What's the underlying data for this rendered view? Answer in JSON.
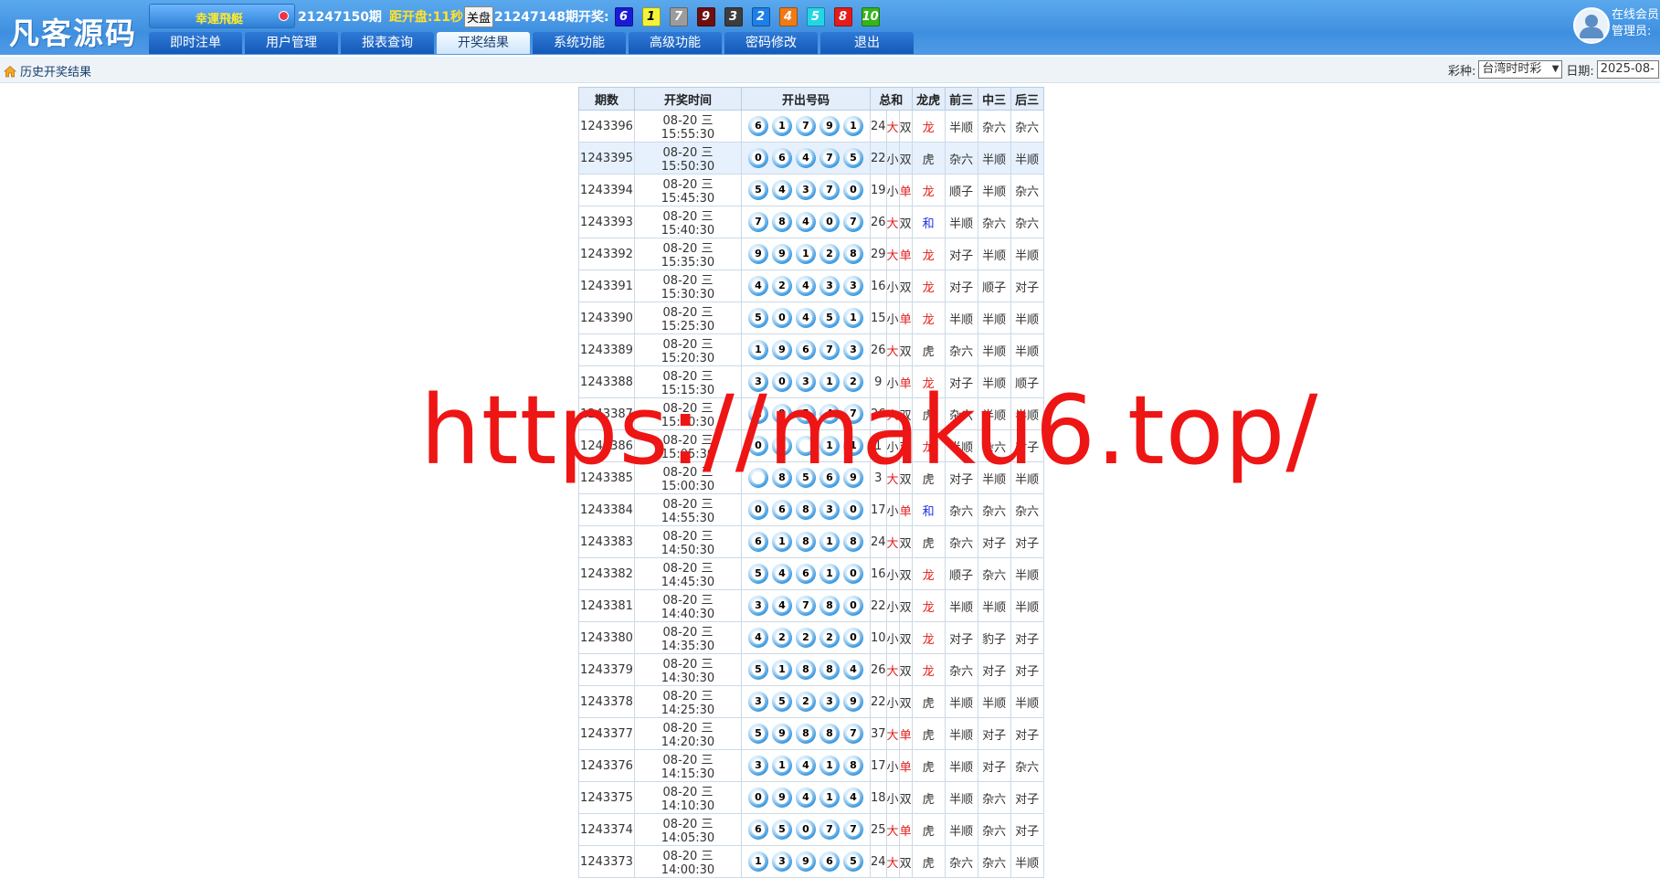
{
  "header": {
    "logo": "凡客源码",
    "game_name": "幸運飛艇",
    "current_issue": "21247150期",
    "countdown": "距开盘:11秒",
    "close_label": "关盘",
    "last_issue": "21247148期开奖:",
    "result_balls": [
      {
        "n": "6",
        "bg": "#1a1ad6",
        "fg": "#ffffff"
      },
      {
        "n": "1",
        "bg": "#f5f23a",
        "fg": "#000000"
      },
      {
        "n": "7",
        "bg": "#9c9c9c",
        "fg": "#ffffff"
      },
      {
        "n": "9",
        "bg": "#6e0f0f",
        "fg": "#ffffff"
      },
      {
        "n": "3",
        "bg": "#3d3d3d",
        "fg": "#ffffff"
      },
      {
        "n": "2",
        "bg": "#1d7fe8",
        "fg": "#ffffff"
      },
      {
        "n": "4",
        "bg": "#f07a16",
        "fg": "#ffffff"
      },
      {
        "n": "5",
        "bg": "#22d6e8",
        "fg": "#ffffff"
      },
      {
        "n": "8",
        "bg": "#e41b1b",
        "fg": "#ffffff"
      },
      {
        "n": "10",
        "bg": "#35b51a",
        "fg": "#ffffff"
      }
    ],
    "nav": [
      "即时注单",
      "用户管理",
      "报表查询",
      "开奖结果",
      "系统功能",
      "高级功能",
      "密码修改",
      "退出"
    ],
    "active_nav": 3,
    "user_line1": "在线会员",
    "user_line2": "管理员:"
  },
  "subbar": {
    "crumb": "历史开奖结果",
    "lottery_label": "彩种:",
    "lottery_value": "台湾时时彩",
    "date_label": "日期:",
    "date_value": "2025-08-"
  },
  "table": {
    "headers": [
      "期数",
      "开奖时间",
      "开出号码",
      "总和",
      "龙虎",
      "前三",
      "中三",
      "后三"
    ],
    "rows": [
      {
        "id": "1243396",
        "time": "08-20 三 15:55:30",
        "balls": [
          "6",
          "1",
          "7",
          "9",
          "1"
        ],
        "sum": "24",
        "bs": "大",
        "oe": "双",
        "dt": "龙",
        "f3": "半顺",
        "m3": "杂六",
        "b3": "杂六"
      },
      {
        "id": "1243395",
        "time": "08-20 三 15:50:30",
        "balls": [
          "0",
          "6",
          "4",
          "7",
          "5"
        ],
        "sum": "22",
        "bs": "小",
        "oe": "双",
        "dt": "虎",
        "f3": "杂六",
        "m3": "半顺",
        "b3": "半顺"
      },
      {
        "id": "1243394",
        "time": "08-20 三 15:45:30",
        "balls": [
          "5",
          "4",
          "3",
          "7",
          "0"
        ],
        "sum": "19",
        "bs": "小",
        "oe": "单",
        "dt": "龙",
        "f3": "顺子",
        "m3": "半顺",
        "b3": "杂六"
      },
      {
        "id": "1243393",
        "time": "08-20 三 15:40:30",
        "balls": [
          "7",
          "8",
          "4",
          "0",
          "7"
        ],
        "sum": "26",
        "bs": "大",
        "oe": "双",
        "dt": "和",
        "f3": "半顺",
        "m3": "杂六",
        "b3": "杂六"
      },
      {
        "id": "1243392",
        "time": "08-20 三 15:35:30",
        "balls": [
          "9",
          "9",
          "1",
          "2",
          "8"
        ],
        "sum": "29",
        "bs": "大",
        "oe": "单",
        "dt": "龙",
        "f3": "对子",
        "m3": "半顺",
        "b3": "半顺"
      },
      {
        "id": "1243391",
        "time": "08-20 三 15:30:30",
        "balls": [
          "4",
          "2",
          "4",
          "3",
          "3"
        ],
        "sum": "16",
        "bs": "小",
        "oe": "双",
        "dt": "龙",
        "f3": "对子",
        "m3": "顺子",
        "b3": "对子"
      },
      {
        "id": "1243390",
        "time": "08-20 三 15:25:30",
        "balls": [
          "5",
          "0",
          "4",
          "5",
          "1"
        ],
        "sum": "15",
        "bs": "小",
        "oe": "单",
        "dt": "龙",
        "f3": "半顺",
        "m3": "半顺",
        "b3": "半顺"
      },
      {
        "id": "1243389",
        "time": "08-20 三 15:20:30",
        "balls": [
          "1",
          "9",
          "6",
          "7",
          "3"
        ],
        "sum": "26",
        "bs": "大",
        "oe": "双",
        "dt": "虎",
        "f3": "杂六",
        "m3": "半顺",
        "b3": "半顺"
      },
      {
        "id": "1243388",
        "time": "08-20 三 15:15:30",
        "balls": [
          "3",
          "0",
          "3",
          "1",
          "2"
        ],
        "sum": "9",
        "bs": "小",
        "oe": "单",
        "dt": "龙",
        "f3": "对子",
        "m3": "半顺",
        "b3": "顺子"
      },
      {
        "id": "1243387",
        "time": "08-20 三 15:10:30",
        "balls": [
          "1",
          "9",
          "5",
          "4",
          "7"
        ],
        "sum": "26",
        "bs": "大",
        "oe": "双",
        "dt": "虎",
        "f3": "杂六",
        "m3": "半顺",
        "b3": "半顺"
      },
      {
        "id": "1243386",
        "time": "08-20 三 15:05:30",
        "balls": [
          "0",
          "",
          "",
          "1",
          "1"
        ],
        "sum": "1",
        "bs": "小",
        "oe": "双",
        "dt": "龙",
        "f3": "半顺",
        "m3": "杂六",
        "b3": "对子"
      },
      {
        "id": "1243385",
        "time": "08-20 三 15:00:30",
        "balls": [
          "",
          "8",
          "5",
          "6",
          "9"
        ],
        "sum": "3",
        "bs": "大",
        "oe": "双",
        "dt": "虎",
        "f3": "对子",
        "m3": "半顺",
        "b3": "半顺"
      },
      {
        "id": "1243384",
        "time": "08-20 三 14:55:30",
        "balls": [
          "0",
          "6",
          "8",
          "3",
          "0"
        ],
        "sum": "17",
        "bs": "小",
        "oe": "单",
        "dt": "和",
        "f3": "杂六",
        "m3": "杂六",
        "b3": "杂六"
      },
      {
        "id": "1243383",
        "time": "08-20 三 14:50:30",
        "balls": [
          "6",
          "1",
          "8",
          "1",
          "8"
        ],
        "sum": "24",
        "bs": "大",
        "oe": "双",
        "dt": "虎",
        "f3": "杂六",
        "m3": "对子",
        "b3": "对子"
      },
      {
        "id": "1243382",
        "time": "08-20 三 14:45:30",
        "balls": [
          "5",
          "4",
          "6",
          "1",
          "0"
        ],
        "sum": "16",
        "bs": "小",
        "oe": "双",
        "dt": "龙",
        "f3": "顺子",
        "m3": "杂六",
        "b3": "半顺"
      },
      {
        "id": "1243381",
        "time": "08-20 三 14:40:30",
        "balls": [
          "3",
          "4",
          "7",
          "8",
          "0"
        ],
        "sum": "22",
        "bs": "小",
        "oe": "双",
        "dt": "龙",
        "f3": "半顺",
        "m3": "半顺",
        "b3": "半顺"
      },
      {
        "id": "1243380",
        "time": "08-20 三 14:35:30",
        "balls": [
          "4",
          "2",
          "2",
          "2",
          "0"
        ],
        "sum": "10",
        "bs": "小",
        "oe": "双",
        "dt": "龙",
        "f3": "对子",
        "m3": "豹子",
        "b3": "对子"
      },
      {
        "id": "1243379",
        "time": "08-20 三 14:30:30",
        "balls": [
          "5",
          "1",
          "8",
          "8",
          "4"
        ],
        "sum": "26",
        "bs": "大",
        "oe": "双",
        "dt": "龙",
        "f3": "杂六",
        "m3": "对子",
        "b3": "对子"
      },
      {
        "id": "1243378",
        "time": "08-20 三 14:25:30",
        "balls": [
          "3",
          "5",
          "2",
          "3",
          "9"
        ],
        "sum": "22",
        "bs": "小",
        "oe": "双",
        "dt": "虎",
        "f3": "半顺",
        "m3": "半顺",
        "b3": "半顺"
      },
      {
        "id": "1243377",
        "time": "08-20 三 14:20:30",
        "balls": [
          "5",
          "9",
          "8",
          "8",
          "7"
        ],
        "sum": "37",
        "bs": "大",
        "oe": "单",
        "dt": "虎",
        "f3": "半顺",
        "m3": "对子",
        "b3": "对子"
      },
      {
        "id": "1243376",
        "time": "08-20 三 14:15:30",
        "balls": [
          "3",
          "1",
          "4",
          "1",
          "8"
        ],
        "sum": "17",
        "bs": "小",
        "oe": "单",
        "dt": "虎",
        "f3": "半顺",
        "m3": "对子",
        "b3": "杂六"
      },
      {
        "id": "1243375",
        "time": "08-20 三 14:10:30",
        "balls": [
          "0",
          "9",
          "4",
          "1",
          "4"
        ],
        "sum": "18",
        "bs": "小",
        "oe": "双",
        "dt": "虎",
        "f3": "半顺",
        "m3": "杂六",
        "b3": "对子"
      },
      {
        "id": "1243374",
        "time": "08-20 三 14:05:30",
        "balls": [
          "6",
          "5",
          "0",
          "7",
          "7"
        ],
        "sum": "25",
        "bs": "大",
        "oe": "单",
        "dt": "虎",
        "f3": "半顺",
        "m3": "杂六",
        "b3": "对子"
      },
      {
        "id": "1243373",
        "time": "08-20 三 14:00:30",
        "balls": [
          "1",
          "3",
          "9",
          "6",
          "5"
        ],
        "sum": "24",
        "bs": "大",
        "oe": "双",
        "dt": "虎",
        "f3": "杂六",
        "m3": "杂六",
        "b3": "半顺"
      }
    ],
    "highlight_row": 1
  },
  "watermark": "https://maku6.top/"
}
